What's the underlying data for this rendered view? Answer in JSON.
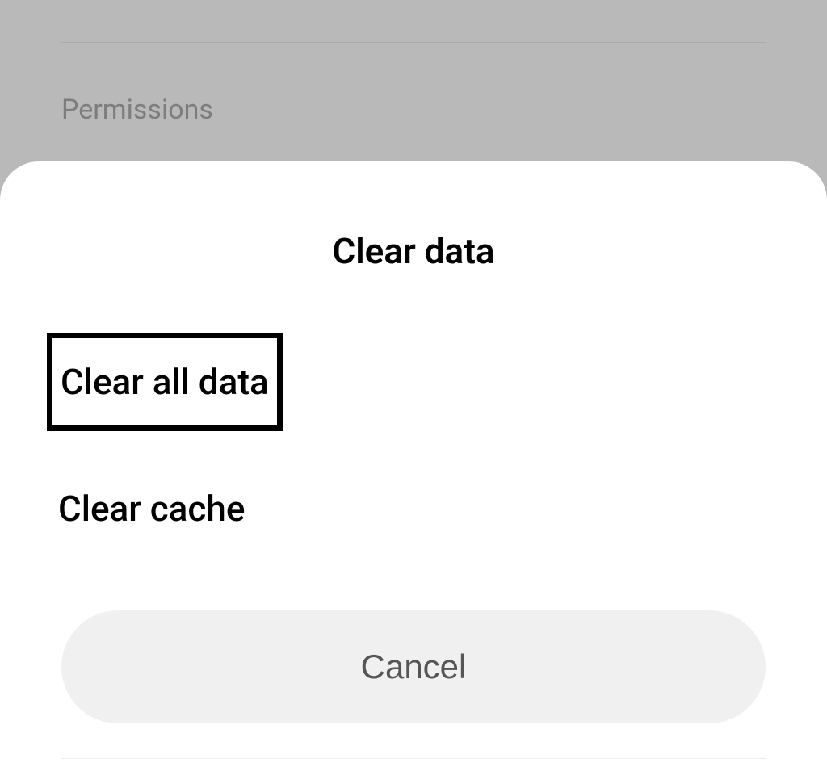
{
  "background": {
    "section_label": "Permissions"
  },
  "modal": {
    "title": "Clear data",
    "options": {
      "clear_all_data": "Clear all data",
      "clear_cache": "Clear cache"
    },
    "cancel_label": "Cancel"
  }
}
